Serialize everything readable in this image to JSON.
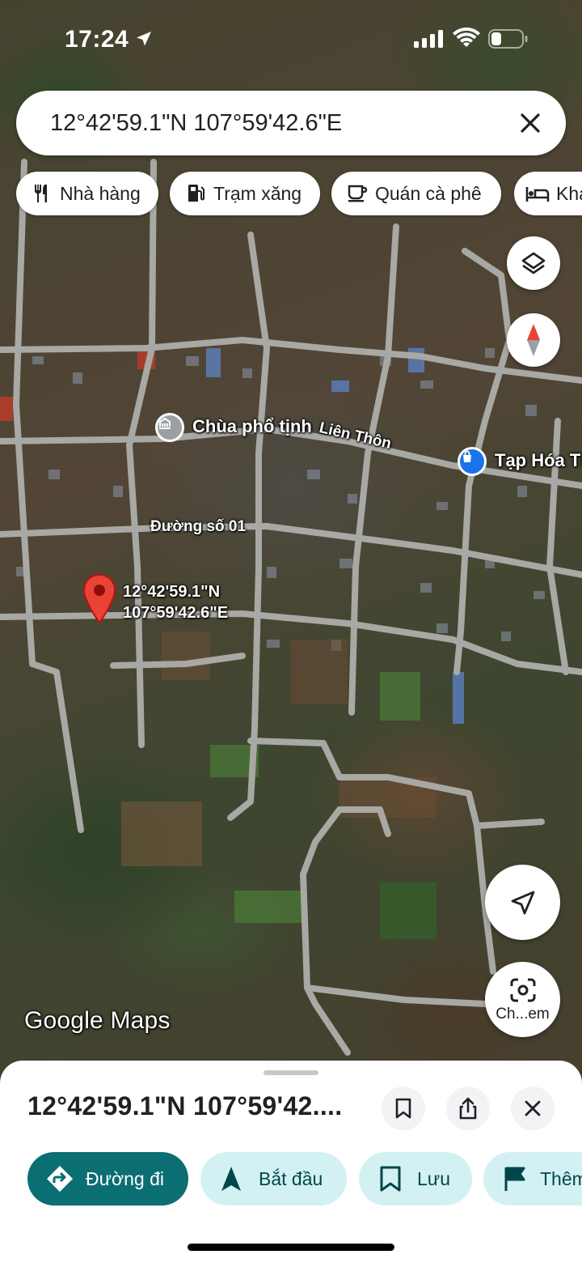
{
  "status_bar": {
    "time": "17:24"
  },
  "search": {
    "query": "12°42'59.1\"N 107°59'42.6\"E"
  },
  "chips": [
    {
      "label": "Nhà hàng",
      "icon": "restaurant-icon"
    },
    {
      "label": "Trạm xăng",
      "icon": "gas-station-icon"
    },
    {
      "label": "Quán cà phê",
      "icon": "coffee-icon"
    },
    {
      "label": "Kha",
      "icon": "hotel-icon"
    }
  ],
  "map": {
    "labels": {
      "temple": "Chùa phổ tịnh",
      "road_lien_thon": "Liên Thôn",
      "shop": "Tạp Hóa Th",
      "road_01": "Đường số 01",
      "pin_lat": "12°42'59.1\"N",
      "pin_lng": "107°59'42.6\"E"
    },
    "watermark": "Google Maps",
    "camera_button_label": "Ch...em",
    "colors": {
      "pin": "#EA4335",
      "temple_poi": "#9AA0A6",
      "shop_poi": "#1A73E8",
      "compass_red": "#EA4335"
    }
  },
  "sheet": {
    "title": "12°42'59.1\"N 107°59'42....",
    "actions": [
      {
        "label": "Đường đi",
        "icon": "directions-icon"
      },
      {
        "label": "Bắt đầu",
        "icon": "navigation-icon"
      },
      {
        "label": "Lưu",
        "icon": "bookmark-icon"
      },
      {
        "label": "Thêm",
        "icon": "flag-icon"
      }
    ],
    "colors": {
      "primary": "#0B6E73",
      "secondary_bg": "#D3F1F3",
      "secondary_fg": "#00474C"
    }
  }
}
